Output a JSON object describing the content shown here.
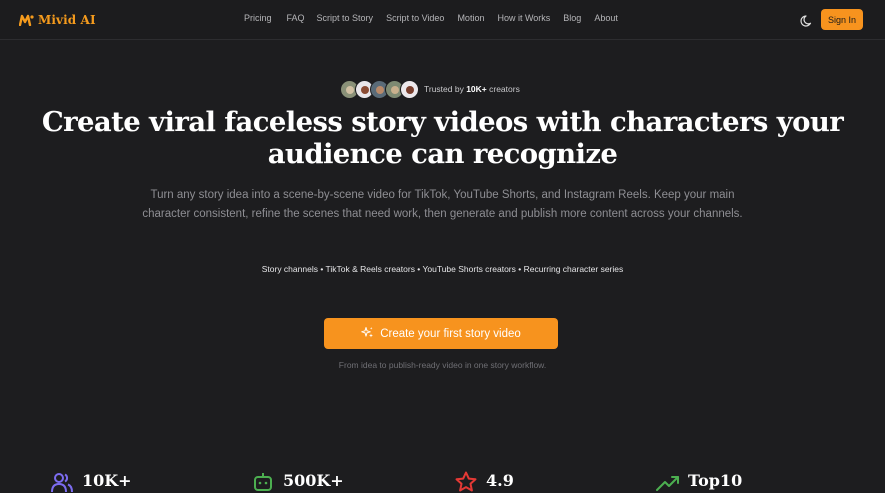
{
  "brand": {
    "name": "Mivid AI",
    "color": "#f59b1d"
  },
  "nav": {
    "links": [
      "Pricing",
      "FAQ",
      "Script to Story",
      "Script to Video",
      "Motion",
      "How it Works",
      "Blog",
      "About"
    ],
    "theme_icon": "moon-icon",
    "signin_label": "Sign In"
  },
  "trust": {
    "prefix": "Trusted by ",
    "count": "10K+",
    "suffix": " creators",
    "avatar_count": 5
  },
  "hero": {
    "title_line1": "Create viral faceless story videos with characters your",
    "title_line2": "audience can recognize",
    "subtitle_line1": "Turn any story idea into a scene-by-scene video for TikTok, YouTube Shorts, and Instagram Reels. Keep your main",
    "subtitle_line2": "character consistent, refine the scenes that need work, then generate and publish more content across your channels.",
    "audiences": "Story channels • TikTok & Reels creators • YouTube Shorts creators • Recurring character series",
    "cta_label": "Create your first story video",
    "cta_icon": "sparkles-icon",
    "cta_note": "From idea to publish-ready video in one story workflow."
  },
  "stats": [
    {
      "icon": "users-icon",
      "value": "10K+",
      "color": "#7c6cf0"
    },
    {
      "icon": "robot-icon",
      "value": "500K+",
      "color": "#4caf50"
    },
    {
      "icon": "star-icon",
      "value": "4.9",
      "color": "#e53935"
    },
    {
      "icon": "trending-up-icon",
      "value": "Top10",
      "color": "#4caf50"
    }
  ],
  "colors": {
    "accent": "#f7931e",
    "background": "#1d1d1f"
  }
}
